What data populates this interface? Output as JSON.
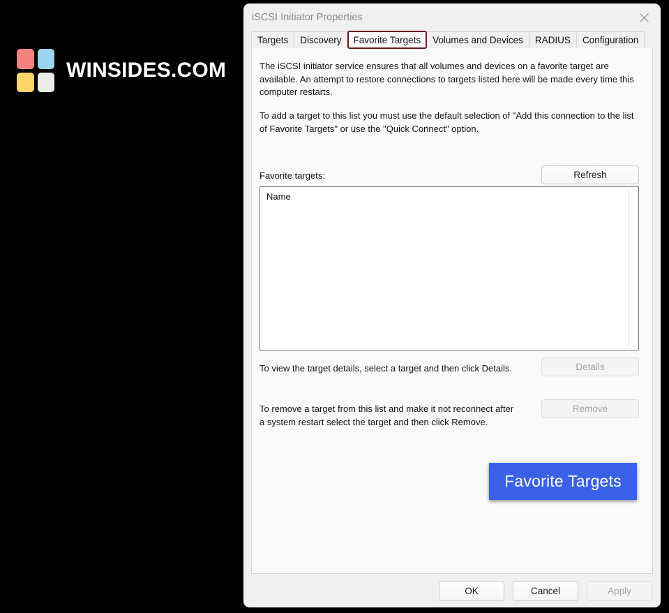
{
  "brand": {
    "name": "WINSIDES.COM",
    "tiles": [
      {
        "name": "tile-top-left",
        "color": "#f4837f"
      },
      {
        "name": "tile-top-right",
        "color": "#9bd3f0"
      },
      {
        "name": "tile-bottom-left",
        "color": "#fbd46a"
      },
      {
        "name": "tile-bottom-right",
        "color": "#eceee6"
      }
    ]
  },
  "dialog": {
    "title": "iSCSI Initiator Properties",
    "close_icon": "close-icon",
    "tabs": [
      {
        "label": "Targets",
        "active": false
      },
      {
        "label": "Discovery",
        "active": false
      },
      {
        "label": "Favorite Targets",
        "active": true
      },
      {
        "label": "Volumes and Devices",
        "active": false
      },
      {
        "label": "RADIUS",
        "active": false
      },
      {
        "label": "Configuration",
        "active": false
      }
    ],
    "active_tab_border_color": "#6b1414"
  },
  "page": {
    "description_1": "The iSCSI initiator service ensures that all volumes and devices on a favorite target are available.  An attempt to restore connections to targets listed here will be made every time this computer restarts.",
    "description_2": "To add a target to this list you must use the default selection of \"Add this connection to the list of Favorite Targets\" or use the \"Quick Connect\" option.",
    "favorite_targets_label": "Favorite targets:",
    "refresh_button": "Refresh",
    "list": {
      "columns": [
        "Name"
      ],
      "rows": []
    },
    "details_text": "To view the target details, select a target and then click Details.",
    "details_button": "Details",
    "details_button_enabled": false,
    "remove_text": "To remove a target from this list and make it not reconnect after a system restart select the target and then click Remove.",
    "remove_button": "Remove",
    "remove_button_enabled": false
  },
  "callout": {
    "text": "Favorite Targets",
    "color": "#3a61e8"
  },
  "footer": {
    "ok_button": "OK",
    "cancel_button": "Cancel",
    "apply_button": "Apply",
    "apply_enabled": false
  }
}
